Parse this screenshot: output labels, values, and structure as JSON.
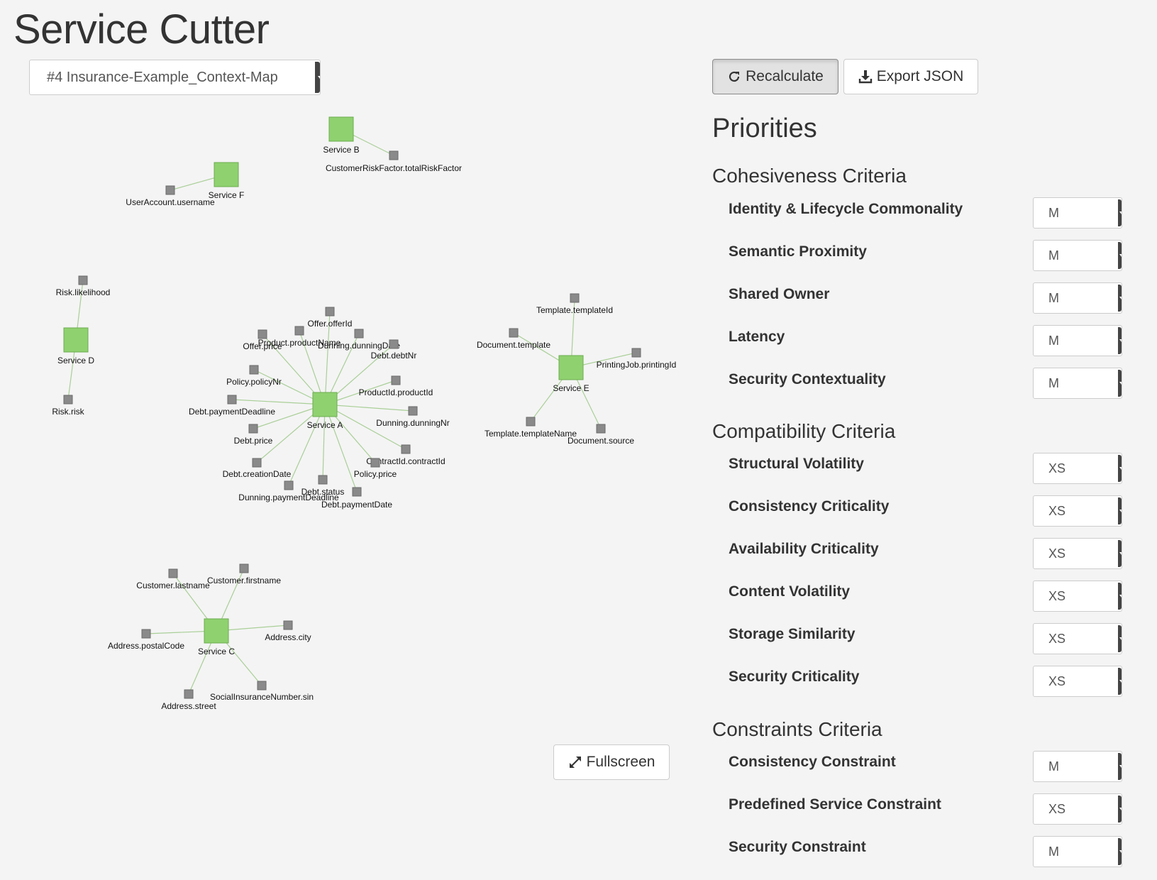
{
  "app": {
    "title": "Service Cutter"
  },
  "model_select": {
    "value": "#4 Insurance-Example_Context-Map"
  },
  "toolbar": {
    "recalculate_label": "Recalculate",
    "export_label": "Export JSON",
    "fullscreen_label": "Fullscreen"
  },
  "priorities": {
    "title": "Priorities",
    "sections": [
      {
        "title": "Cohesiveness Criteria",
        "criteria": [
          {
            "label": "Identity & Lifecycle Commonality",
            "value": "M"
          },
          {
            "label": "Semantic Proximity",
            "value": "M"
          },
          {
            "label": "Shared Owner",
            "value": "M"
          },
          {
            "label": "Latency",
            "value": "M"
          },
          {
            "label": "Security Contextuality",
            "value": "M"
          }
        ]
      },
      {
        "title": "Compatibility Criteria",
        "criteria": [
          {
            "label": "Structural Volatility",
            "value": "XS"
          },
          {
            "label": "Consistency Criticality",
            "value": "XS"
          },
          {
            "label": "Availability Criticality",
            "value": "XS"
          },
          {
            "label": "Content Volatility",
            "value": "XS"
          },
          {
            "label": "Storage Similarity",
            "value": "XS"
          },
          {
            "label": "Security Criticality",
            "value": "XS"
          }
        ]
      },
      {
        "title": "Constraints Criteria",
        "criteria": [
          {
            "label": "Consistency Constraint",
            "value": "M"
          },
          {
            "label": "Predefined Service Constraint",
            "value": "XS"
          },
          {
            "label": "Security Constraint",
            "value": "M"
          }
        ]
      }
    ]
  },
  "graph": {
    "colors": {
      "service": "#8fd16f",
      "service_border": "#6cad4f",
      "nanoentity": "#8a8a8a",
      "nanoentity_border": "#6a6a6a",
      "edge": "#a9cf97"
    },
    "services": [
      {
        "name": "Service A",
        "entities": [
          "Offer.offerId",
          "Product.productName",
          "Dunning.dunningDate",
          "Debt.debtNr",
          "Offer.price",
          "Policy.policyNr",
          "ProductId.productId",
          "Debt.paymentDeadline",
          "Dunning.dunningNr",
          "Debt.price",
          "ContractId.contractId",
          "Debt.creationDate",
          "Policy.price",
          "Dunning.paymentDeadline",
          "Debt.status",
          "Debt.paymentDate"
        ]
      },
      {
        "name": "Service B",
        "entities": [
          "CustomerRiskFactor.totalRiskFactor"
        ]
      },
      {
        "name": "Service C",
        "entities": [
          "Customer.lastname",
          "Customer.firstname",
          "Address.postalCode",
          "Address.city",
          "Address.street",
          "SocialInsuranceNumber.sin"
        ]
      },
      {
        "name": "Service D",
        "entities": [
          "Risk.likelihood",
          "Risk.risk"
        ]
      },
      {
        "name": "Service E",
        "entities": [
          "Template.templateId",
          "Document.template",
          "PrintingJob.printingId",
          "Template.templateName",
          "Document.source"
        ]
      },
      {
        "name": "Service F",
        "entities": [
          "UserAccount.username"
        ]
      }
    ]
  }
}
